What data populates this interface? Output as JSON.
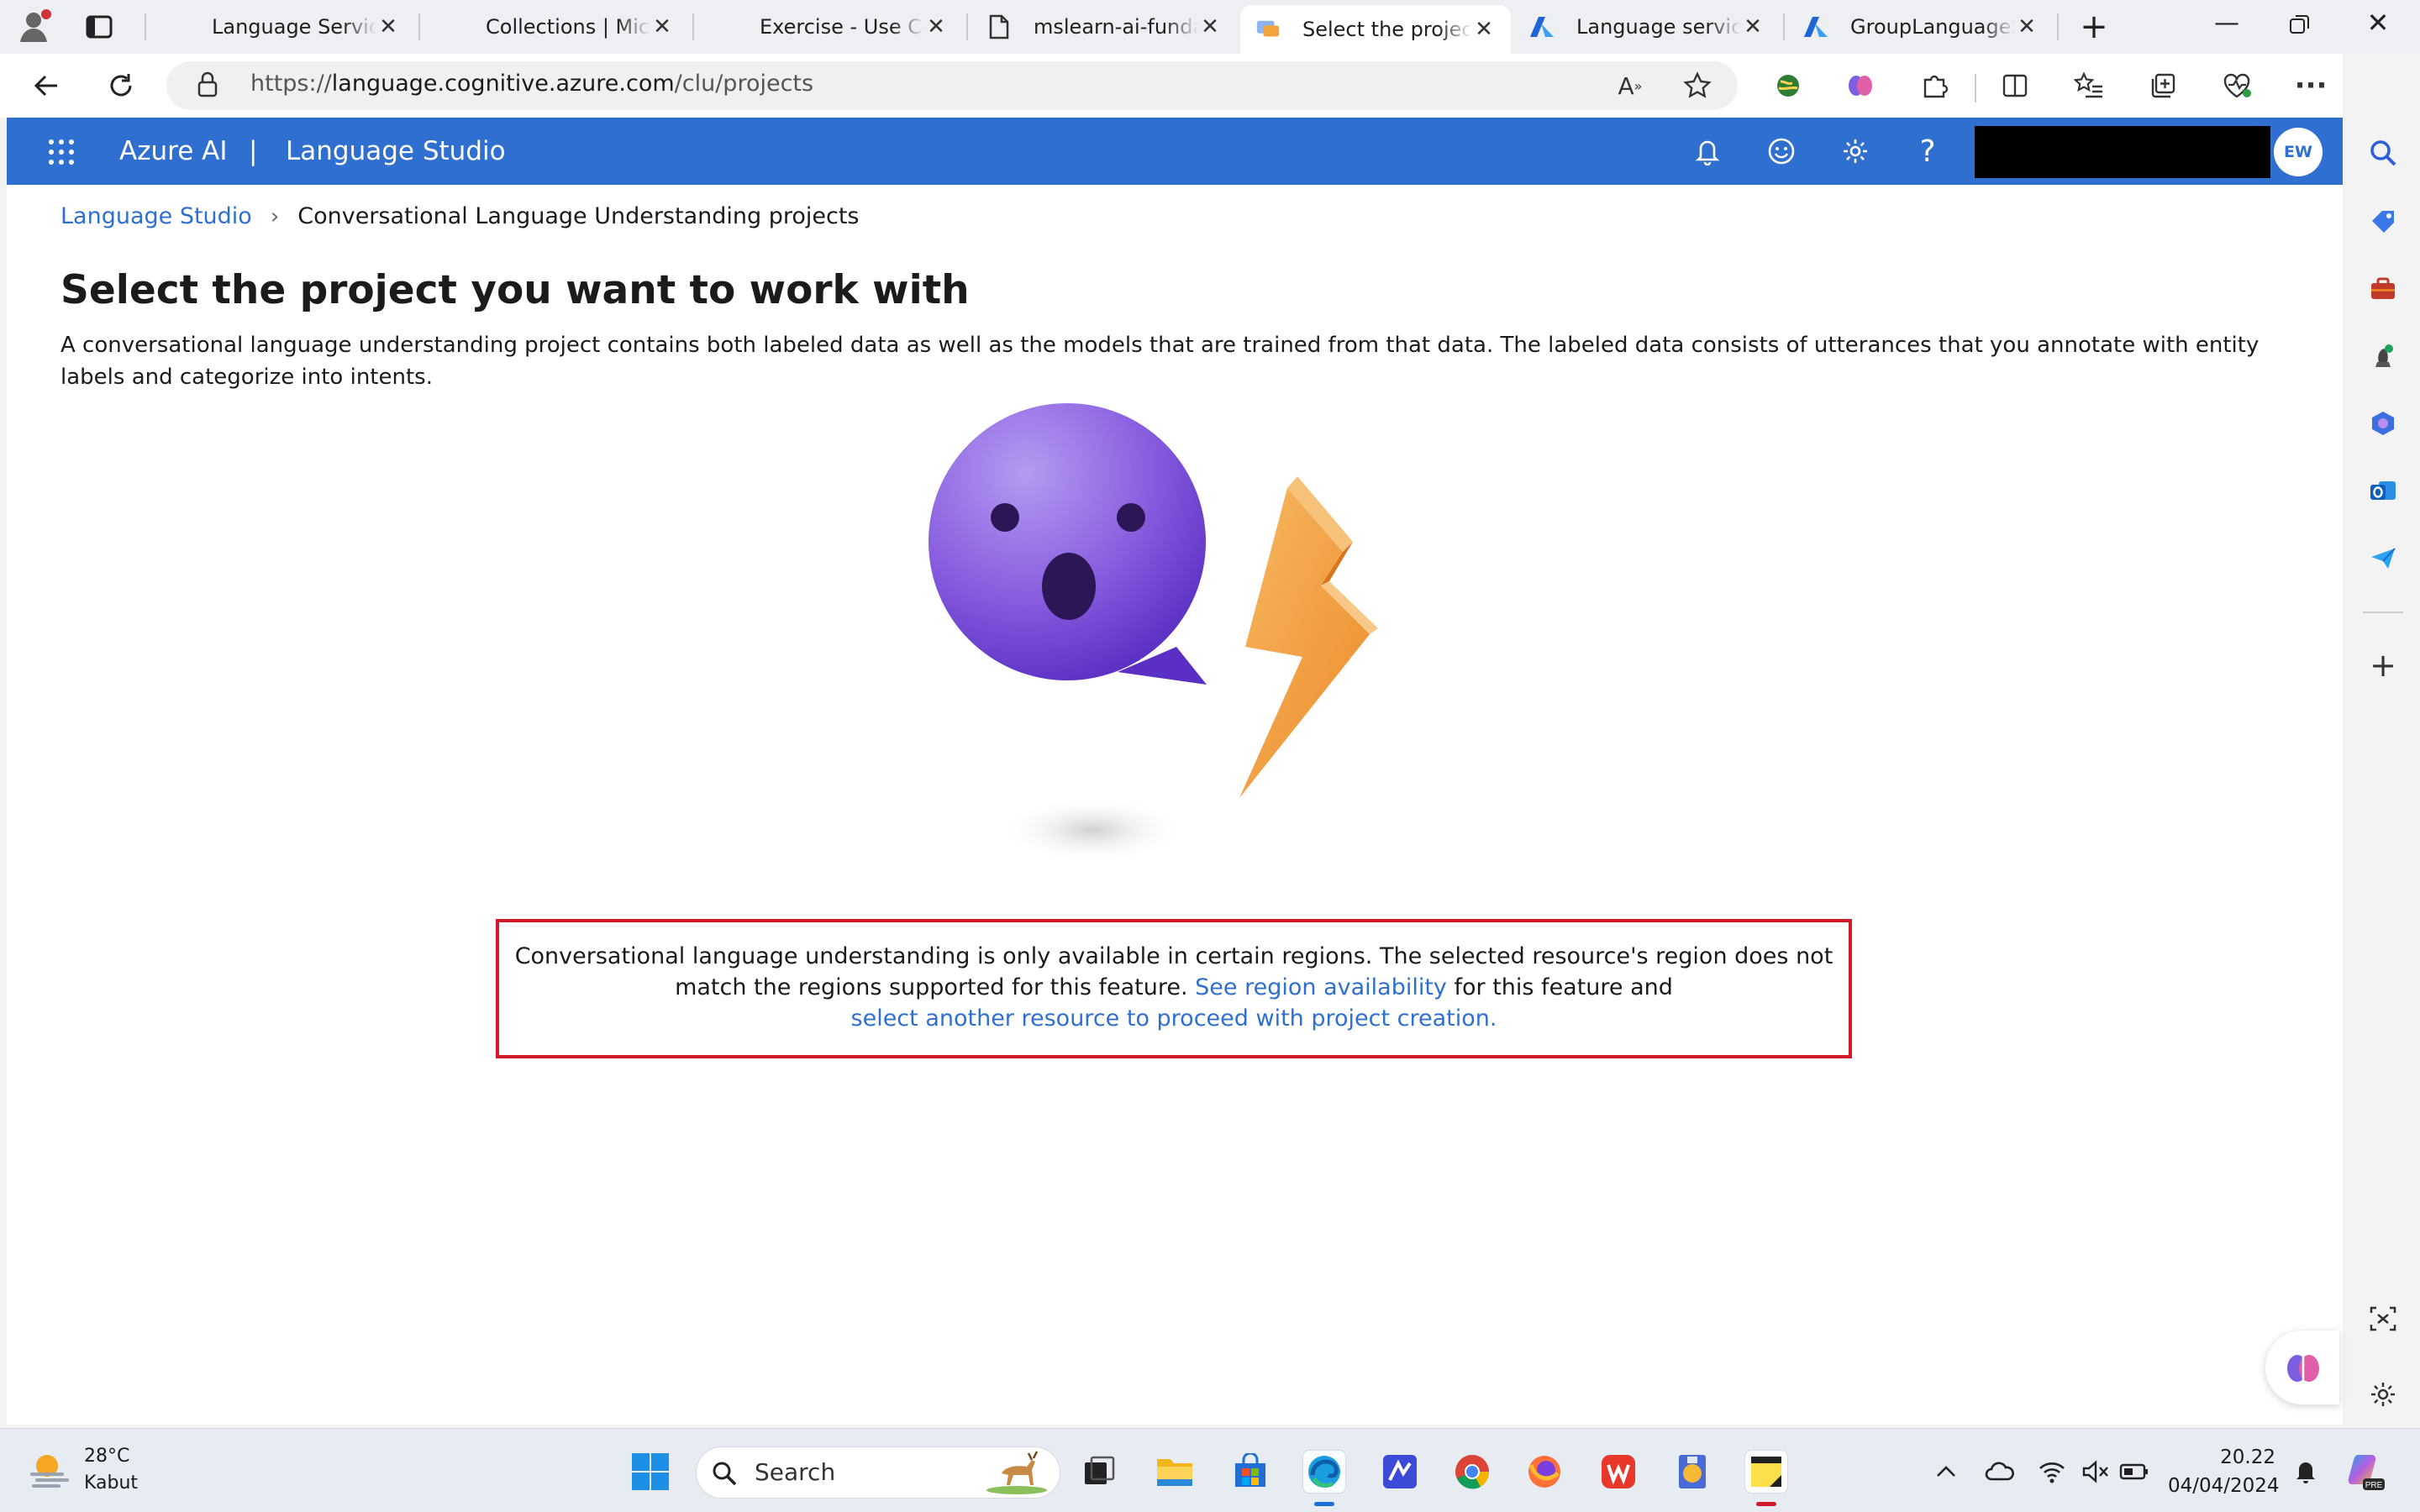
{
  "browser": {
    "tabs": [
      {
        "title": "Language Service",
        "favicon": "microsoft-logo"
      },
      {
        "title": "Collections | Micro",
        "favicon": "microsoft-logo"
      },
      {
        "title": "Exercise - Use Con",
        "favicon": "microsoft-logo"
      },
      {
        "title": "mslearn-ai-fundam",
        "favicon": "document-icon"
      },
      {
        "title": "Select the project",
        "favicon": "language-studio-icon",
        "active": true
      },
      {
        "title": "Language service",
        "favicon": "azure-icon"
      },
      {
        "title": "GroupLanguageSe",
        "favicon": "azure-icon"
      }
    ],
    "url_prefix": "https://",
    "url_domain": "language.cognitive.azure.com",
    "url_path": "/clu/projects"
  },
  "app_header": {
    "brand": "Azure AI",
    "divider": "|",
    "product": "Language Studio",
    "avatar_initials": "EW"
  },
  "breadcrumb": {
    "root": "Language Studio",
    "current": "Conversational Language Understanding projects"
  },
  "page": {
    "title": "Select the project you want to work with",
    "description": "A conversational language understanding project contains both labeled data as well as the models that are trained from that data. The labeled data consists of utterances that you annotate with entity labels and categorize into intents."
  },
  "notice": {
    "text_before": "Conversational language understanding is only available in certain regions. The selected resource's region does not match the regions supported for this feature. ",
    "link_region": "See region availability",
    "text_middle": " for this feature and",
    "link_select": "select another resource to proceed with project creation."
  },
  "taskbar": {
    "weather_temp": "28°C",
    "weather_condition": "Kabut",
    "search_placeholder": "Search",
    "time": "20.22",
    "date": "04/04/2024"
  },
  "colors": {
    "header_blue": "#2f6fcf",
    "link_blue": "#2f6fcf",
    "notice_border": "#d11a2a"
  }
}
